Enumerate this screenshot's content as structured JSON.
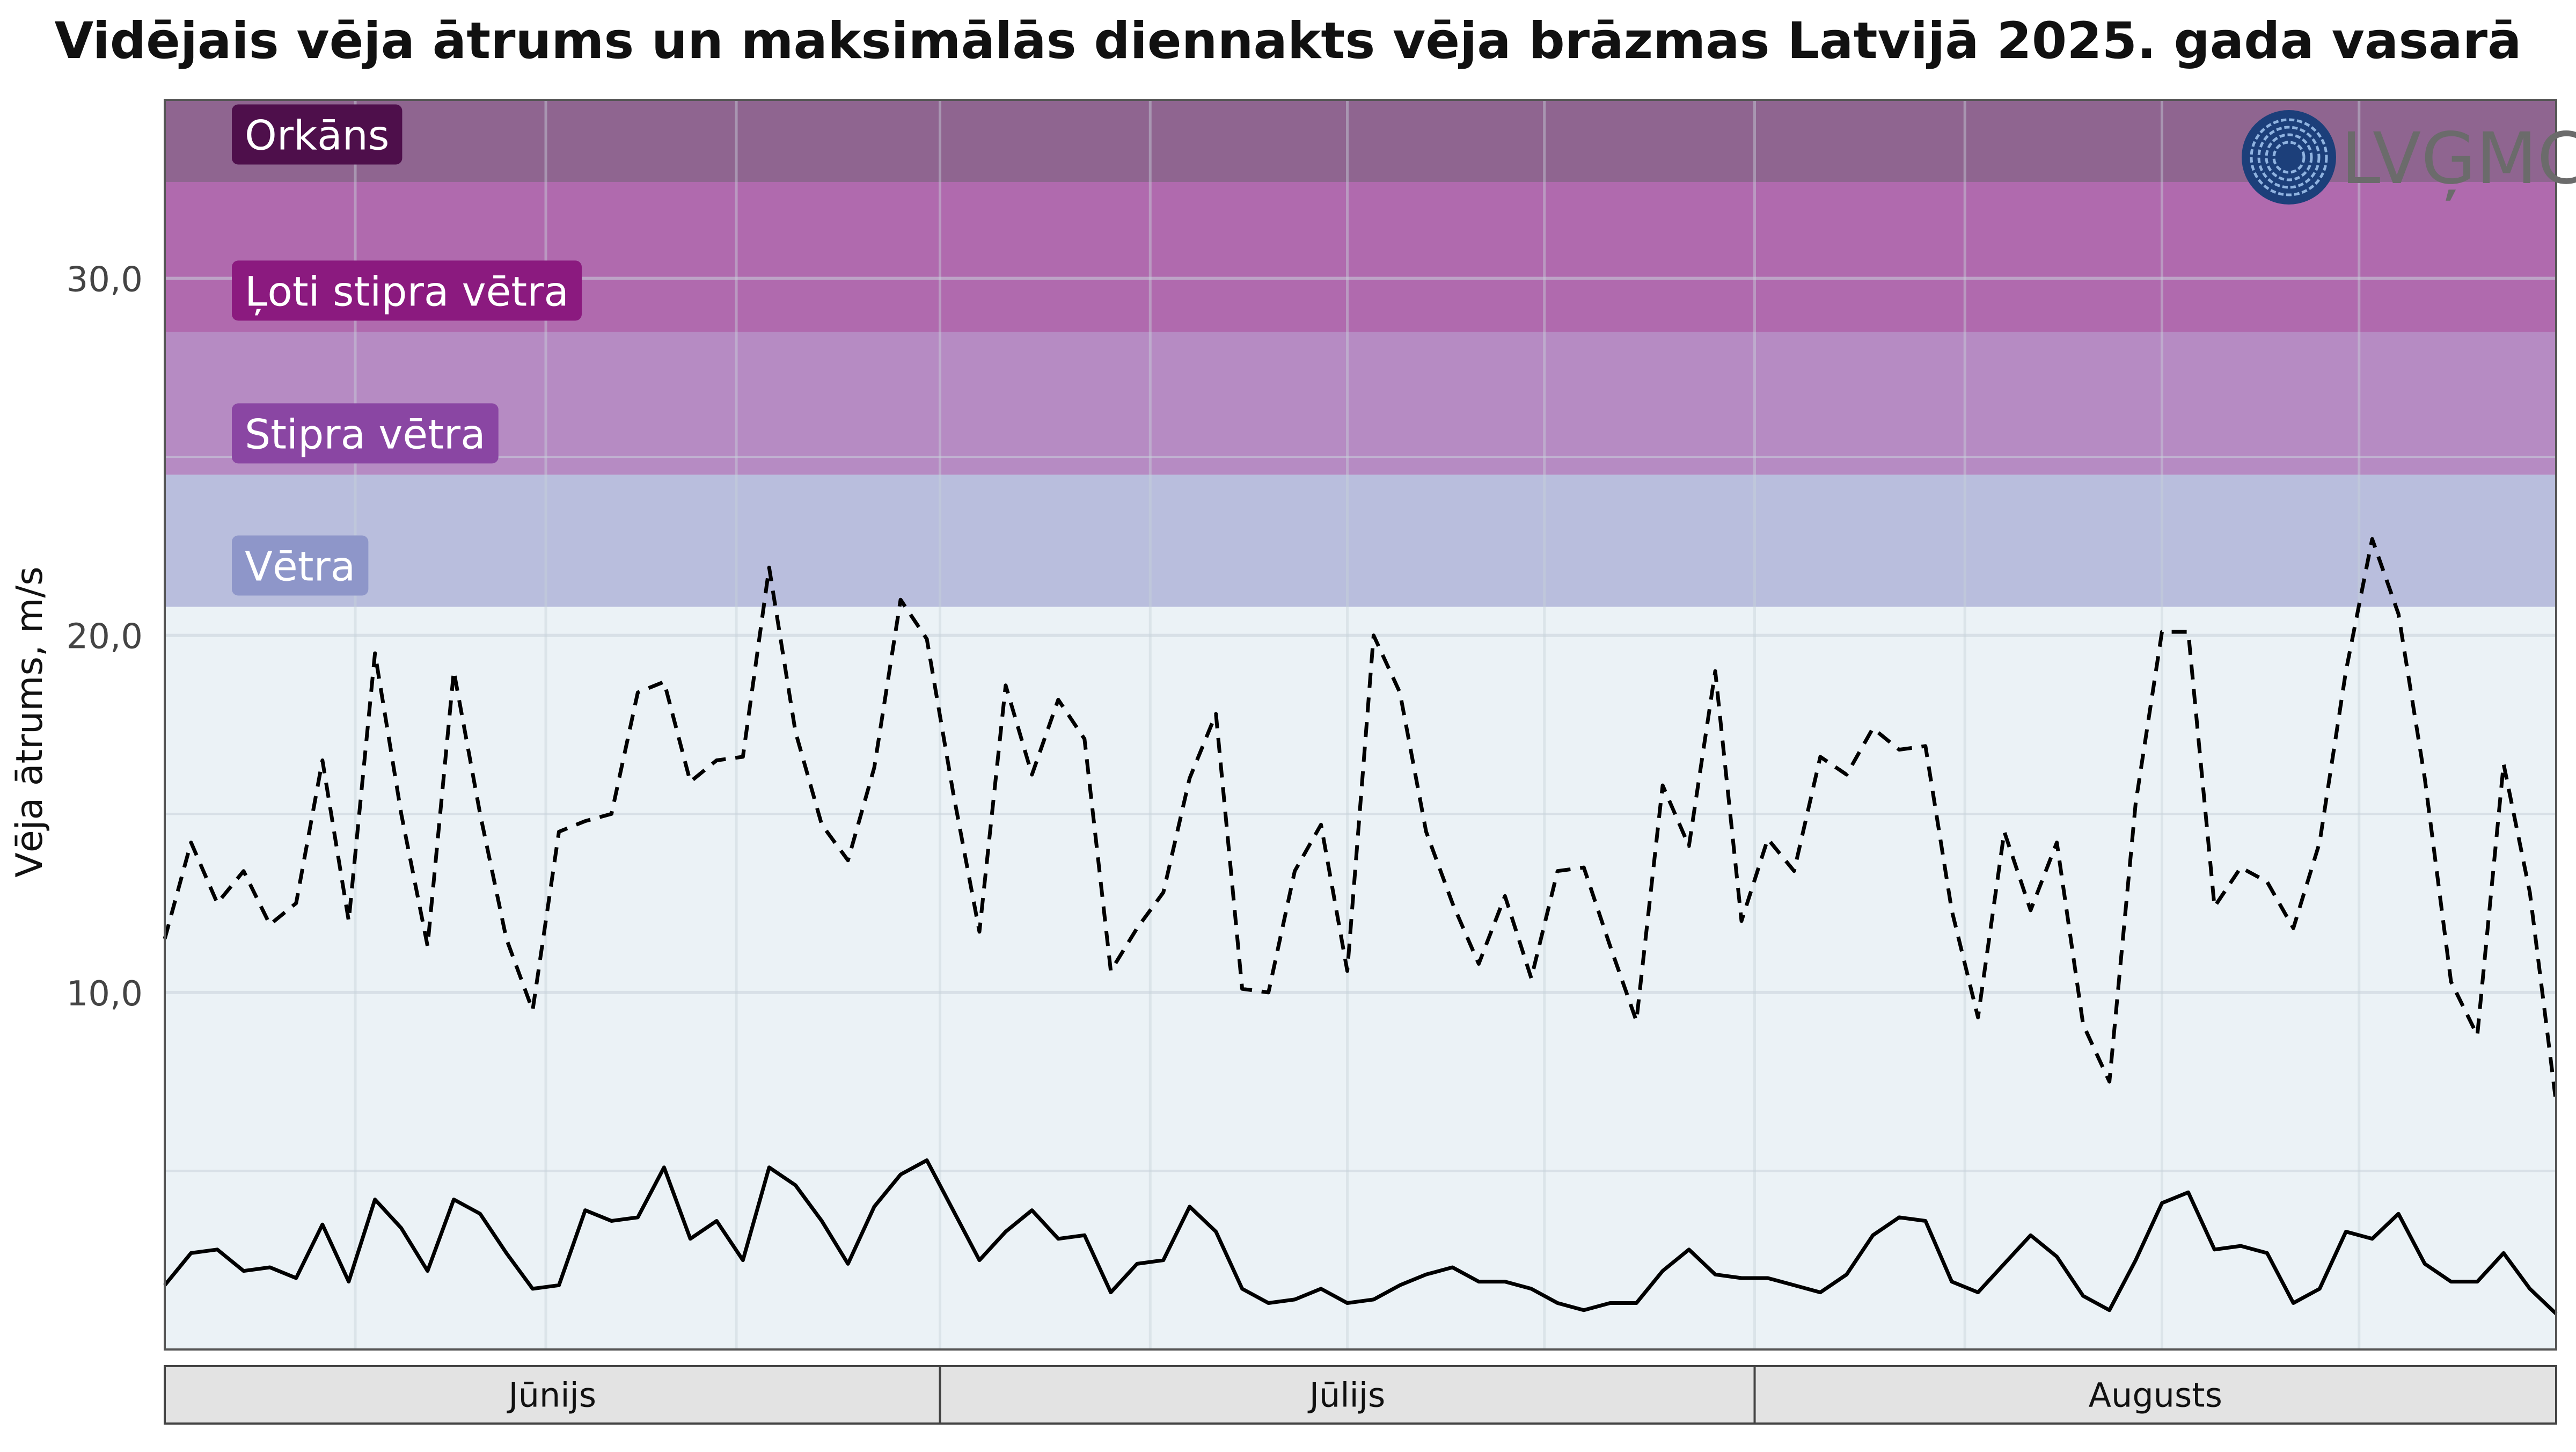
{
  "chart_data": {
    "type": "line",
    "title": "Vidējais vēja ātrums un maksimālās diennakts vēja brāzmas Latvijā 2025. gada vasarā",
    "xlabel": "",
    "ylabel": "Vēja ātrums, m/s",
    "ylim": [
      0,
      35
    ],
    "y_ticks": [
      10,
      20,
      30
    ],
    "y_tick_labels": [
      "10,0",
      "20,0",
      "30,0"
    ],
    "grid": true,
    "legend": "none",
    "logo_text": "LVĢMC",
    "months": [
      {
        "label": "Jūnijs",
        "start": "2025-06-01",
        "end": "2025-06-30"
      },
      {
        "label": "Jūlijs",
        "start": "2025-07-01",
        "end": "2025-07-31"
      },
      {
        "label": "Augusts",
        "start": "2025-08-01",
        "end": "2025-08-31"
      }
    ],
    "bands": [
      {
        "label": "Vētra",
        "from": 20.8,
        "to": 24.5,
        "color": "#b9bedd",
        "label_bg": "#8e96c9"
      },
      {
        "label": "Stipra vētra",
        "from": 24.5,
        "to": 28.5,
        "color": "#b68bc3",
        "label_bg": "#8a46a3"
      },
      {
        "label": "Ļoti stipra vētra",
        "from": 28.5,
        "to": 32.7,
        "color": "#b06aae",
        "label_bg": "#8b1a7f"
      },
      {
        "label": "Orkāns",
        "from": 32.7,
        "to": 35,
        "color": "#8f6590",
        "label_bg": "#4e0f4b"
      }
    ],
    "background_color": "#ebf2f6",
    "x": [
      "2025-06-01",
      "2025-06-02",
      "2025-06-03",
      "2025-06-04",
      "2025-06-05",
      "2025-06-06",
      "2025-06-07",
      "2025-06-08",
      "2025-06-09",
      "2025-06-10",
      "2025-06-11",
      "2025-06-12",
      "2025-06-13",
      "2025-06-14",
      "2025-06-15",
      "2025-06-16",
      "2025-06-17",
      "2025-06-18",
      "2025-06-19",
      "2025-06-20",
      "2025-06-21",
      "2025-06-22",
      "2025-06-23",
      "2025-06-24",
      "2025-06-25",
      "2025-06-26",
      "2025-06-27",
      "2025-06-28",
      "2025-06-29",
      "2025-06-30",
      "2025-07-01",
      "2025-07-02",
      "2025-07-03",
      "2025-07-04",
      "2025-07-05",
      "2025-07-06",
      "2025-07-07",
      "2025-07-08",
      "2025-07-09",
      "2025-07-10",
      "2025-07-11",
      "2025-07-12",
      "2025-07-13",
      "2025-07-14",
      "2025-07-15",
      "2025-07-16",
      "2025-07-17",
      "2025-07-18",
      "2025-07-19",
      "2025-07-20",
      "2025-07-21",
      "2025-07-22",
      "2025-07-23",
      "2025-07-24",
      "2025-07-25",
      "2025-07-26",
      "2025-07-27",
      "2025-07-28",
      "2025-07-29",
      "2025-07-30",
      "2025-07-31",
      "2025-08-01",
      "2025-08-02",
      "2025-08-03",
      "2025-08-04",
      "2025-08-05",
      "2025-08-06",
      "2025-08-07",
      "2025-08-08",
      "2025-08-09",
      "2025-08-10",
      "2025-08-11",
      "2025-08-12",
      "2025-08-13",
      "2025-08-14",
      "2025-08-15",
      "2025-08-16",
      "2025-08-17",
      "2025-08-18",
      "2025-08-19",
      "2025-08-20",
      "2025-08-21",
      "2025-08-22",
      "2025-08-23",
      "2025-08-24",
      "2025-08-25",
      "2025-08-26",
      "2025-08-27",
      "2025-08-28",
      "2025-08-29",
      "2025-08-30",
      "2025-08-31"
    ],
    "series": [
      {
        "style": "dashed",
        "color": "#000000",
        "values": [
          11.5,
          14.2,
          12.5,
          13.4,
          11.9,
          12.5,
          16.5,
          12.0,
          19.5,
          15.0,
          11.3,
          19.0,
          15.0,
          11.5,
          9.5,
          14.5,
          14.8,
          15.0,
          18.4,
          18.7,
          15.9,
          16.5,
          16.6,
          21.9,
          17.3,
          14.7,
          13.7,
          16.3,
          21.0,
          19.9,
          15.6,
          11.7,
          18.6,
          16.1,
          18.2,
          17.1,
          10.6,
          11.8,
          12.8,
          16.0,
          17.8,
          10.1,
          10.0,
          13.4,
          14.7,
          10.6,
          20.0,
          18.4,
          14.5,
          12.5,
          10.8,
          12.7,
          10.4,
          13.4,
          13.5,
          11.3,
          9.2,
          15.8,
          14.1,
          19.0,
          12.0,
          14.3,
          13.4,
          16.6,
          16.1,
          17.4,
          16.8,
          16.9,
          12.3,
          9.3,
          14.5,
          12.3,
          14.2,
          9.1,
          7.5,
          15.3,
          20.1,
          20.1,
          12.4,
          13.5,
          13.1,
          11.8,
          14.2,
          19.0,
          22.7,
          20.6,
          16.0,
          10.3,
          8.8,
          16.4,
          12.8,
          6.9
        ]
      },
      {
        "style": "solid",
        "color": "#000000",
        "values": [
          1.8,
          2.7,
          2.8,
          2.2,
          2.3,
          2.0,
          3.5,
          1.9,
          4.2,
          3.4,
          2.2,
          4.2,
          3.8,
          2.7,
          1.7,
          1.8,
          3.9,
          3.6,
          3.7,
          5.1,
          3.1,
          3.6,
          2.5,
          5.1,
          4.6,
          3.6,
          2.4,
          4.0,
          4.9,
          5.3,
          3.9,
          2.5,
          3.3,
          3.9,
          3.1,
          3.2,
          1.6,
          2.4,
          2.5,
          4.0,
          3.3,
          1.7,
          1.3,
          1.4,
          1.7,
          1.3,
          1.4,
          1.8,
          2.1,
          2.3,
          1.9,
          1.9,
          1.7,
          1.3,
          1.1,
          1.3,
          1.3,
          2.2,
          2.8,
          2.1,
          2.0,
          2.0,
          1.8,
          1.6,
          2.1,
          3.2,
          3.7,
          3.6,
          1.9,
          1.6,
          2.4,
          3.2,
          2.6,
          1.5,
          1.1,
          2.5,
          4.1,
          4.4,
          2.8,
          2.9,
          2.7,
          1.3,
          1.7,
          3.3,
          3.1,
          3.8,
          2.4,
          1.9,
          1.9,
          2.7,
          1.7,
          1.0
        ]
      }
    ]
  }
}
